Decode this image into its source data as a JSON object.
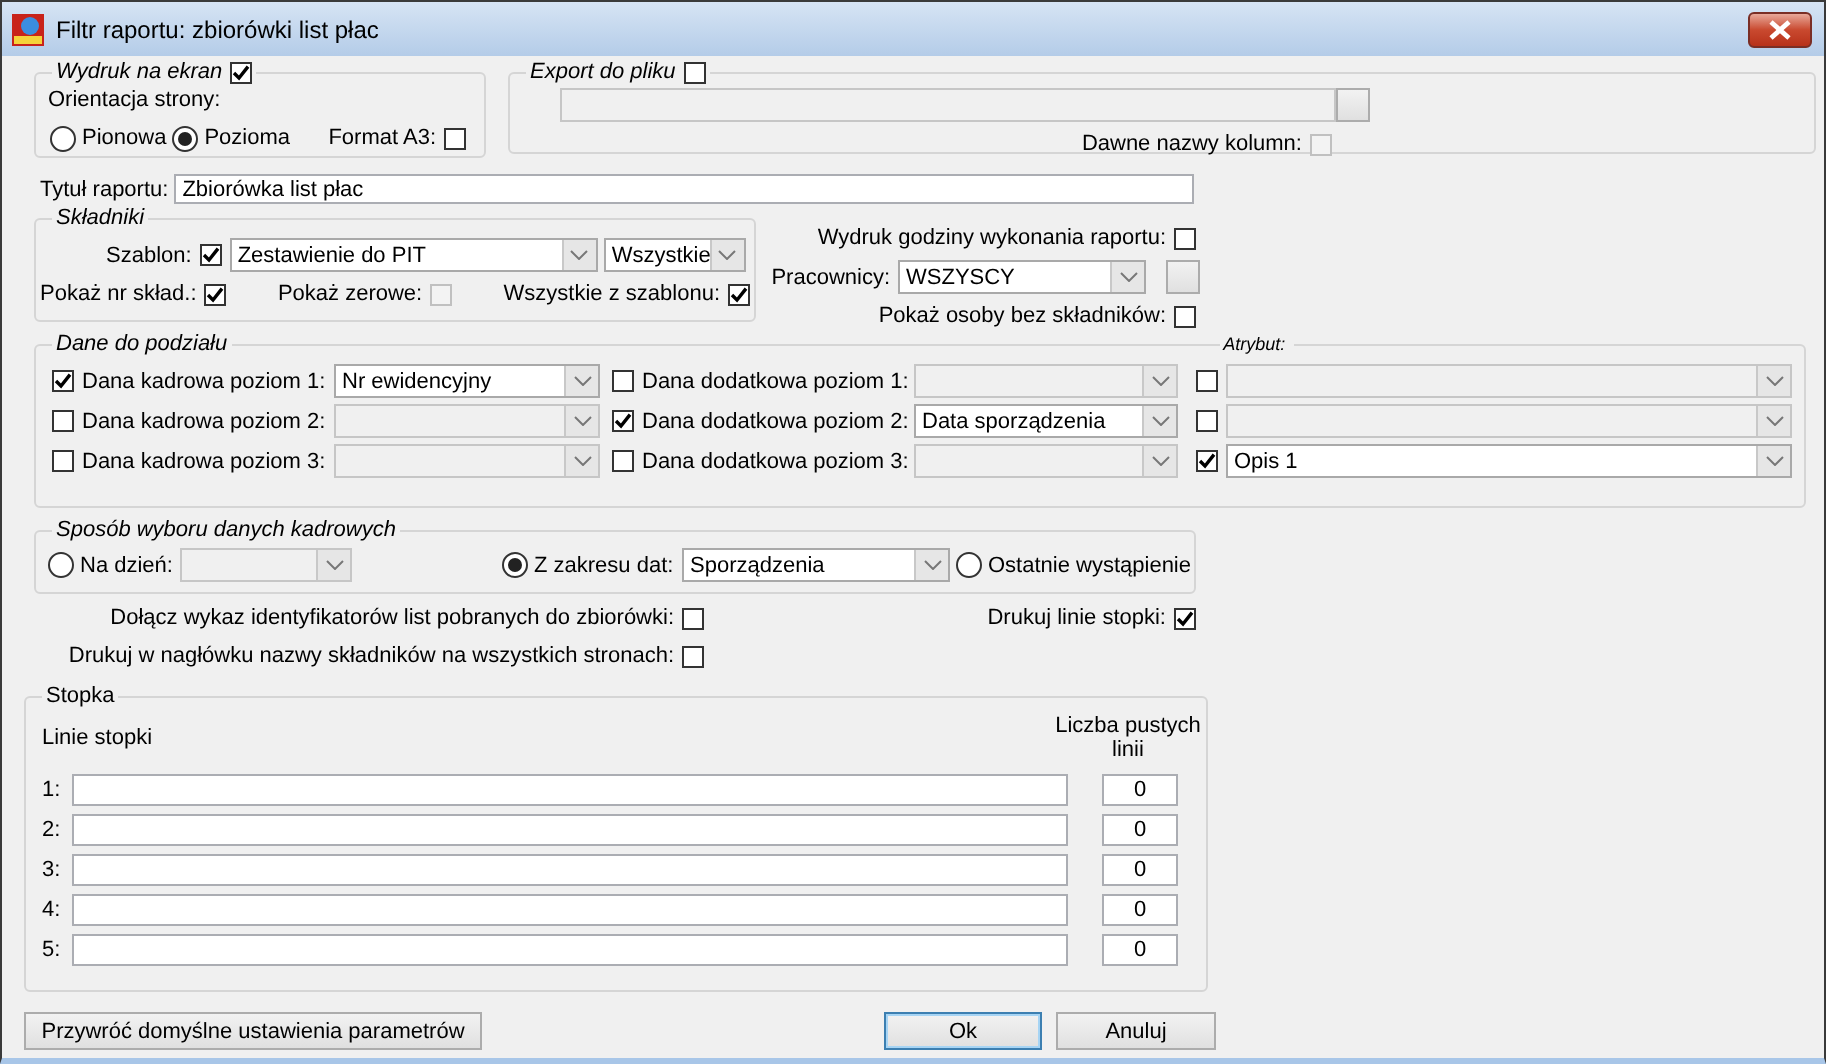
{
  "window": {
    "title": "Filtr raportu: zbiorówki list płac"
  },
  "screen_print": {
    "label": "Wydruk na ekran",
    "checked": true,
    "orientation_label": "Orientacja strony:",
    "orientations": [
      {
        "label": "Pionowa",
        "selected": false
      },
      {
        "label": "Pozioma",
        "selected": true
      }
    ],
    "format_a3": {
      "label": "Format A3:",
      "checked": false
    }
  },
  "export": {
    "label": "Export do pliku",
    "checked": false,
    "path": {
      "disabled": true
    },
    "old_column_names": {
      "label": "Dawne nazwy kolumn:",
      "checked": false,
      "disabled": true
    }
  },
  "report_title": {
    "label": "Tytuł raportu:",
    "value": "Zbiorówka list płac"
  },
  "components": {
    "legend": "Składniki",
    "template": {
      "label": "Szablon:",
      "checked": true,
      "value": "Zestawienie do PIT",
      "scope": "Wszystkie"
    },
    "options": [
      {
        "label": "Pokaż nr skład.:",
        "checked": true,
        "disabled": false
      },
      {
        "label": "Pokaż zerowe:",
        "checked": false,
        "disabled": true
      },
      {
        "label": "Wszystkie z szablonu:",
        "checked": true,
        "disabled": false
      }
    ]
  },
  "print_time": {
    "label": "Wydruk godziny wykonania raportu:",
    "checked": false
  },
  "employees": {
    "label": "Pracownicy:",
    "value": "WSZYSCY"
  },
  "show_without_components": {
    "label": "Pokaż osoby bez składników:",
    "checked": false
  },
  "split_data": {
    "legend": "Dane do podziału",
    "attribute_legend": "Atrybut:",
    "rows": [
      {
        "hr": {
          "label": "Dana kadrowa poziom 1:",
          "checked": true,
          "value": "Nr ewidencyjny",
          "disabled": false
        },
        "extra": {
          "label": "Dana dodatkowa poziom 1:",
          "checked": false,
          "disabled": true
        },
        "attribute": {
          "checked": false,
          "disabled": true
        }
      },
      {
        "hr": {
          "label": "Dana kadrowa poziom 2:",
          "checked": false,
          "disabled": true
        },
        "extra": {
          "label": "Dana dodatkowa poziom 2:",
          "checked": true,
          "value": "Data sporządzenia",
          "disabled": false
        },
        "attribute": {
          "checked": false,
          "disabled": true
        }
      },
      {
        "hr": {
          "label": "Dana kadrowa poziom 3:",
          "checked": false,
          "disabled": true
        },
        "extra": {
          "label": "Dana dodatkowa poziom 3:",
          "checked": false,
          "disabled": true
        },
        "attribute": {
          "checked": true,
          "value": "Opis 1",
          "disabled": false
        }
      }
    ]
  },
  "selection": {
    "legend": "Sposób wyboru danych kadrowych",
    "options": [
      {
        "kind": "combo",
        "label": "Na dzień:",
        "selected": false,
        "disabled": true
      },
      {
        "kind": "combo",
        "label": "Z zakresu dat:",
        "selected": true,
        "value": "Sporządzenia",
        "disabled": false
      },
      {
        "kind": "plain",
        "label": "Ostatnie wystąpienie",
        "selected": false
      }
    ]
  },
  "attach_ids": {
    "label": "Dołącz wykaz identyfikatorów list pobranych do zbiorówki:",
    "checked": false
  },
  "print_footer_lines": {
    "label": "Drukuj linie stopki:",
    "checked": true
  },
  "header_names": {
    "label": "Drukuj w nagłówku nazwy składników na wszystkich stronach:",
    "checked": false
  },
  "footer": {
    "legend": "Stopka",
    "lines_header": "Linie stopki",
    "count_header": "Liczba pustych linii",
    "lines": [
      {
        "number": "1:",
        "count": "0"
      },
      {
        "number": "2:",
        "count": "0"
      },
      {
        "number": "3:",
        "count": "0"
      },
      {
        "number": "4:",
        "count": "0"
      },
      {
        "number": "5:",
        "count": "0"
      }
    ]
  },
  "buttons": [
    {
      "label": "Przywróć domyślne ustawienia parametrów",
      "default": false
    },
    {
      "label": "Ok",
      "default": true
    },
    {
      "label": "Anuluj",
      "default": false
    }
  ]
}
